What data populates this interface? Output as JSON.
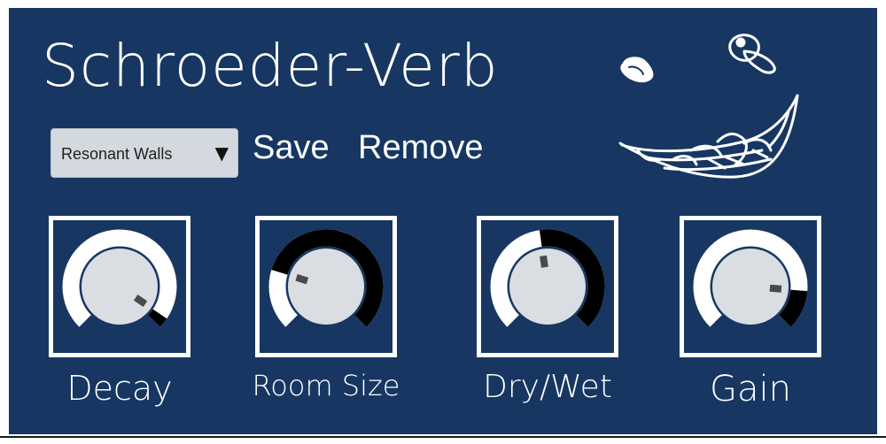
{
  "plugin": {
    "title": "Schroeder-Verb"
  },
  "preset": {
    "selected": "Resonant Walls",
    "arrow": "▼"
  },
  "buttons": {
    "save_label": "Save",
    "remove_label": "Remove"
  },
  "logo": {
    "icon": "sketch-face-leaf-icon"
  },
  "knobs": [
    {
      "id": "decay",
      "label": "Decay",
      "value": 0.96
    },
    {
      "id": "room-size",
      "label": "Room Size",
      "value": 0.23
    },
    {
      "id": "dry-wet",
      "label": "Dry/Wet",
      "value": 0.47
    },
    {
      "id": "gain",
      "label": "Gain",
      "value": 0.85
    }
  ],
  "colors": {
    "background": "#173762",
    "track": "#ffffff",
    "fill": "#000000",
    "knob_face": "#dadde2",
    "pointer": "#4a4a4a"
  }
}
